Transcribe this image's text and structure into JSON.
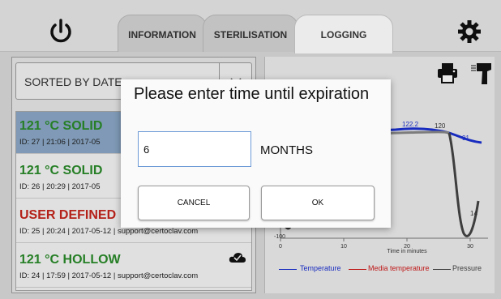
{
  "header": {
    "tabs": [
      {
        "label": "INFORMATION"
      },
      {
        "label": "STERILISATION"
      },
      {
        "label": "LOGGING"
      }
    ]
  },
  "sort": {
    "label": "SORTED BY DATE"
  },
  "list": {
    "items": [
      {
        "title": "121 °C SOLID",
        "meta": "ID: 27 | 21:06 | 2017-05",
        "color": "#2a8a2a",
        "selected": true
      },
      {
        "title": "121 °C SOLID",
        "meta": "ID: 26 | 20:29 | 2017-05",
        "color": "#2a8a2a",
        "selected": false
      },
      {
        "title": "USER DEFINED",
        "meta": "ID: 25 | 20:24 | 2017-05-12 | support@certoclav.com",
        "color": "#c4241c",
        "selected": false
      },
      {
        "title": "121 °C HOLLOW",
        "meta": "ID: 24 | 17:59 | 2017-05-12 | support@certoclav.com",
        "color": "#2a8a2a",
        "selected": false
      }
    ]
  },
  "chart_data": {
    "type": "line",
    "xlabel": "Time in minutes",
    "x_ticks": [
      "0",
      "10",
      "20",
      "30"
    ],
    "y_ticks": [
      "-100"
    ],
    "annotations": [
      "122.2",
      "120",
      "91",
      "14"
    ],
    "series": [
      {
        "name": "Temperature",
        "color": "#1a2fd0"
      },
      {
        "name": "Media temperature",
        "color": "#d01a1a"
      },
      {
        "name": "Pressure",
        "color": "#444444"
      }
    ]
  },
  "dialog": {
    "title": "Please enter time until expiration",
    "input_value": "6",
    "unit": "MONTHS",
    "cancel_label": "CANCEL",
    "ok_label": "OK"
  }
}
